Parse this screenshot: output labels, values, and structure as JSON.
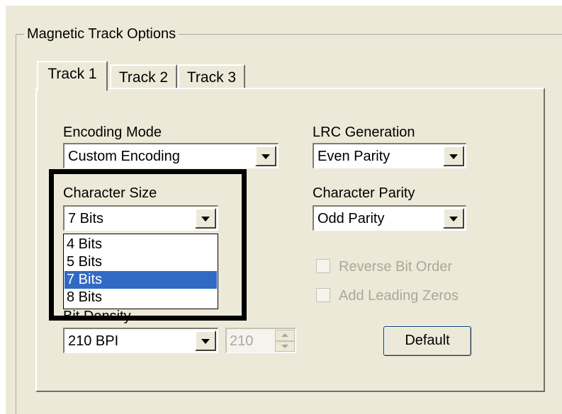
{
  "group": {
    "title": "Magnetic Track Options"
  },
  "tabs": [
    {
      "label": "Track 1",
      "active": true
    },
    {
      "label": "Track 2",
      "active": false
    },
    {
      "label": "Track 3",
      "active": false
    }
  ],
  "encoding_mode": {
    "label": "Encoding Mode",
    "value": "Custom Encoding"
  },
  "lrc_generation": {
    "label": "LRC Generation",
    "value": "Even Parity"
  },
  "character_size": {
    "label": "Character Size",
    "value": "7 Bits",
    "options": [
      "4 Bits",
      "5 Bits",
      "7 Bits",
      "8 Bits"
    ],
    "selected_index": 2
  },
  "character_parity": {
    "label": "Character Parity",
    "value": "Odd Parity"
  },
  "reverse_bit_order": {
    "label": "Reverse Bit Order",
    "checked": false,
    "enabled": false
  },
  "add_leading_zeros": {
    "label": "Add Leading Zeros",
    "checked": false,
    "enabled": false
  },
  "bit_density": {
    "label": "Bit Density",
    "value": "210 BPI",
    "spin_value": "210"
  },
  "default_button": {
    "label": "Default"
  },
  "colors": {
    "dialog_bg": "#ece9d8",
    "selection": "#316ac5",
    "highlight_border": "#000000"
  }
}
